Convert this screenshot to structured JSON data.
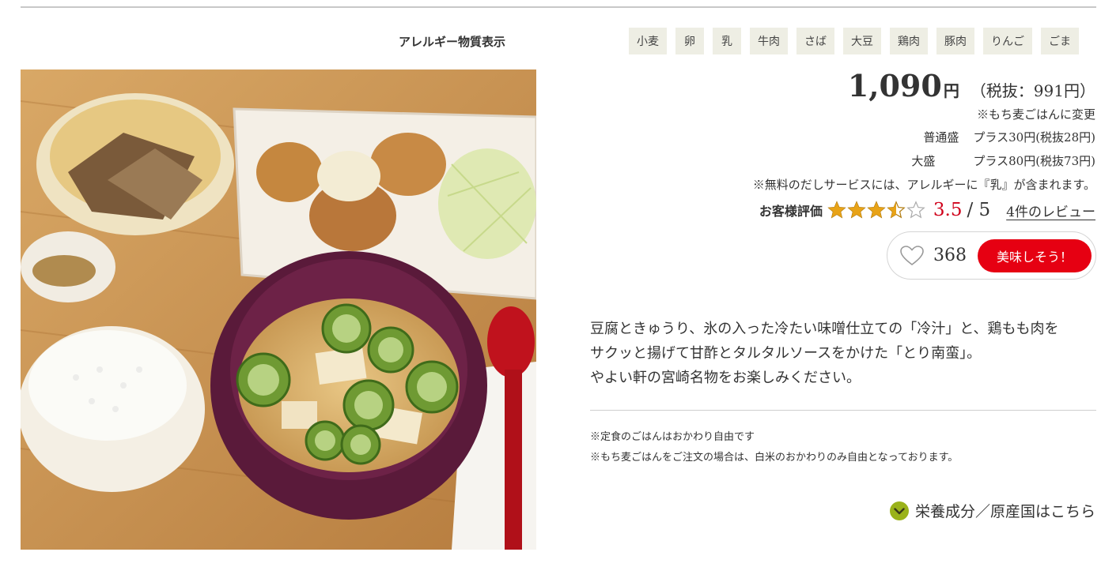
{
  "allergy": {
    "title": "アレルギー物質表示",
    "items": [
      "小麦",
      "卵",
      "乳",
      "牛肉",
      "さば",
      "大豆",
      "鶏肉",
      "豚肉",
      "りんご",
      "ごま"
    ]
  },
  "price": {
    "amount": "1,090",
    "yen": "円",
    "tax_excluded": "（税抜：991円）"
  },
  "notes": {
    "mochi": "※もち麦ごはんに変更",
    "options": [
      {
        "size": "普通盛",
        "extra": "プラス30円(税抜28円)"
      },
      {
        "size": "大盛",
        "extra": "プラス80円(税抜73円)"
      }
    ],
    "dashi": "※無料のだしサービスには、アレルギーに『乳』が含まれます。"
  },
  "rating": {
    "label": "お客様評価",
    "score": "3.5",
    "of": "/ 5",
    "value": 3.5,
    "max": 5,
    "reviews_link": "4件のレビュー"
  },
  "likes": {
    "count": "368",
    "button_label": "美味しそう！"
  },
  "description": {
    "line1": "豆腐ときゅうり、氷の入った冷たい味噌仕立ての「冷汁」と、鶏もも肉を",
    "line2": "サクッと揚げて甘酢とタルタルソースをかけた「とり南蛮」。",
    "line3": "やよい軒の宮崎名物をお楽しみください。"
  },
  "footnotes": {
    "line1": "※定食のごはんはおかわり自由です",
    "line2": "※もち麦ごはんをご注文の場合は、白米のおかわりのみ自由となっております。"
  },
  "nutrition_link": "栄養成分／原産国はこちら",
  "colors": {
    "accent_red": "#e60012",
    "rating_red": "#d0021b",
    "star_gold": "#e8a317",
    "allergen_bg": "#eeeee4",
    "nutrition_icon": "#9ab21a"
  },
  "icons": {
    "heart": "heart-outline-icon",
    "star": "star-icon",
    "expand": "chevron-down-circle-icon"
  }
}
